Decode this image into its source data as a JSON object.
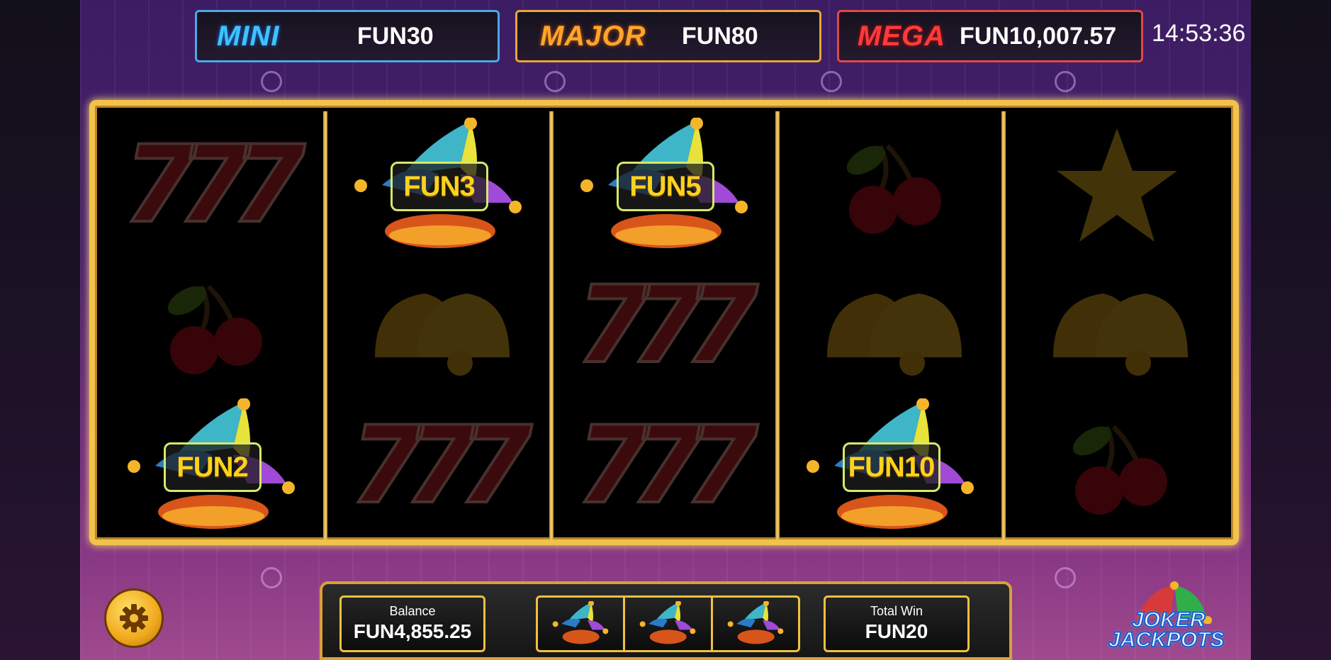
{
  "jackpots": {
    "mini": {
      "name": "MINI",
      "value": "FUN30"
    },
    "major": {
      "name": "MAJOR",
      "value": "FUN80"
    },
    "mega": {
      "name": "MEGA",
      "value": "FUN10,007.57"
    }
  },
  "clock": "14:53:36",
  "reels": [
    [
      "seven",
      "cherry",
      "jester:FUN2"
    ],
    [
      "jester:FUN3",
      "bell",
      "seven"
    ],
    [
      "jester:FUN5",
      "seven",
      "seven"
    ],
    [
      "cherry",
      "bell",
      "jester:FUN10"
    ],
    [
      "star",
      "bell",
      "cherry"
    ]
  ],
  "jester_labels": {
    "r1c3": "FUN2",
    "r2c1": "FUN3",
    "r3c1": "FUN5",
    "r4c3": "FUN10"
  },
  "bottom": {
    "balance_label": "Balance",
    "balance_value": "FUN4,855.25",
    "total_win_label": "Total Win",
    "total_win_value": "FUN20",
    "collected_icons": [
      "jester-hat-icon",
      "jester-hat-icon",
      "jester-hat-icon"
    ]
  },
  "logo": {
    "line1": "JOKER",
    "line2": "JACKPOTS"
  },
  "colors": {
    "mini": "#3ec3ff",
    "major": "#ffa52a",
    "mega": "#ff3a3a",
    "frame": "#f3c24a",
    "jester_label": "#ffd21a"
  }
}
